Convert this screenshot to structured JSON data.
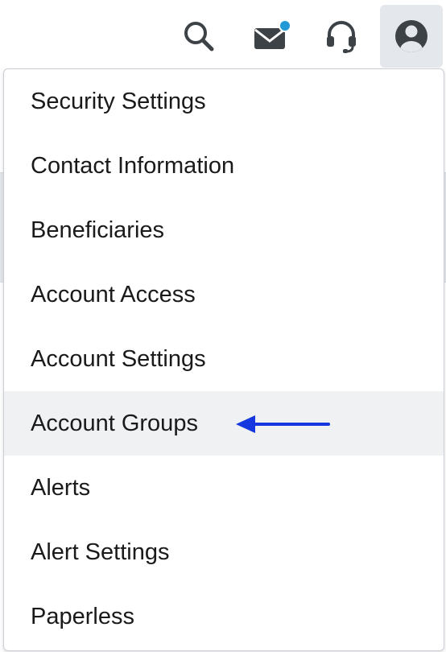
{
  "header": {
    "icons": [
      {
        "name": "search-icon",
        "label": "search"
      },
      {
        "name": "mail-icon",
        "label": "mail",
        "badge_color": "#1f9ad6"
      },
      {
        "name": "headset-icon",
        "label": "support"
      },
      {
        "name": "user-icon",
        "label": "profile",
        "active": true
      }
    ]
  },
  "menu": {
    "items": [
      {
        "label": "Security Settings"
      },
      {
        "label": "Contact Information"
      },
      {
        "label": "Beneficiaries"
      },
      {
        "label": "Account Access"
      },
      {
        "label": "Account Settings"
      },
      {
        "label": "Account Groups",
        "highlighted": true
      },
      {
        "label": "Alerts"
      },
      {
        "label": "Alert Settings"
      },
      {
        "label": "Paperless"
      }
    ]
  },
  "annotation": {
    "arrow_color": "#1537e0",
    "points_to": "Account Groups"
  },
  "colors": {
    "icon": "#3d4247",
    "active_bg": "#e4e8ec",
    "highlight_bg": "#eff1f3",
    "text": "#1a1a1a"
  }
}
